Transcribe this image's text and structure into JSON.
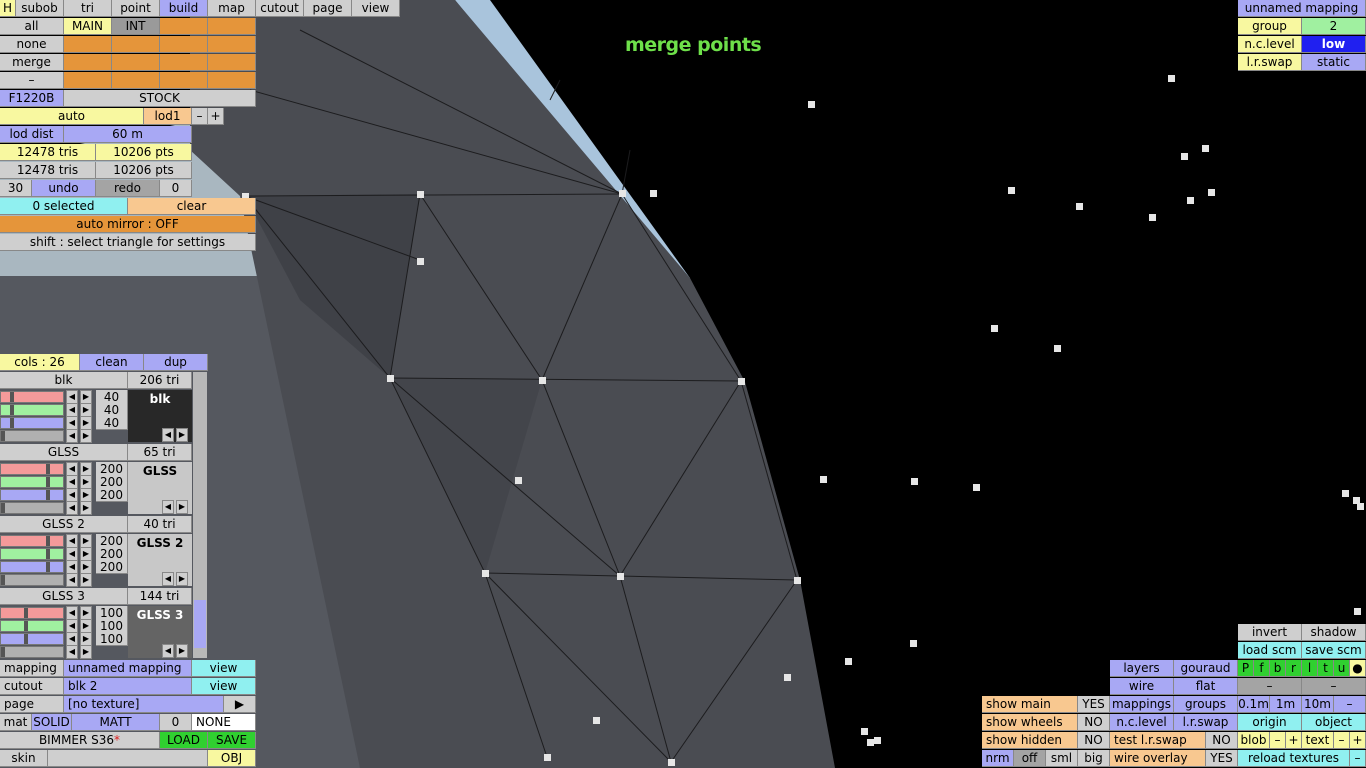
{
  "title": "merge points",
  "top_tabs": [
    "H",
    "subob",
    "tri",
    "point",
    "build",
    "map",
    "cutout",
    "page",
    "view"
  ],
  "selection_buttons": [
    "all",
    "none",
    "merge",
    "–"
  ],
  "main_label": "MAIN",
  "int_label": "INT",
  "model_code": "F1220B",
  "model_variant": "STOCK",
  "lod_mode": "auto",
  "lod_level": "lod1",
  "lod_minus": "–",
  "lod_plus": "+",
  "lod_dist_label": "lod dist",
  "lod_dist_value": "60 m",
  "tri_count_1": "12478 tris",
  "pt_count_1": "10206 pts",
  "tri_count_2": "12478 tris",
  "pt_count_2": "10206 pts",
  "undo_count": "30",
  "undo_label": "undo",
  "redo_label": "redo",
  "redo_count": "0",
  "selected_label": "0 selected",
  "clear_label": "clear",
  "auto_mirror_label": "auto mirror : OFF",
  "hint_label": "shift : select triangle for settings",
  "cols_label": "cols : 26",
  "clean_label": "clean",
  "dup_label": "dup",
  "materials": [
    {
      "name": "blk",
      "tris": "206 tri",
      "r": "40",
      "g": "40",
      "b": "40",
      "r_frac": 0.16,
      "g_frac": 0.16,
      "b_frac": 0.16,
      "swatch_label": "blk",
      "swatch_color": "#282828",
      "swatch_text": "#ffffff"
    },
    {
      "name": "GLSS",
      "tris": "65 tri",
      "r": "200",
      "g": "200",
      "b": "200",
      "r_frac": 0.78,
      "g_frac": 0.78,
      "b_frac": 0.78,
      "swatch_label": "GLSS",
      "swatch_color": "#c8c8c8",
      "swatch_text": "#000000"
    },
    {
      "name": "GLSS 2",
      "tris": "40 tri",
      "r": "200",
      "g": "200",
      "b": "200",
      "r_frac": 0.78,
      "g_frac": 0.78,
      "b_frac": 0.78,
      "swatch_label": "GLSS 2",
      "swatch_color": "#c8c8c8",
      "swatch_text": "#000000"
    },
    {
      "name": "GLSS 3",
      "tris": "144 tri",
      "r": "100",
      "g": "100",
      "b": "100",
      "r_frac": 0.39,
      "g_frac": 0.39,
      "b_frac": 0.39,
      "swatch_label": "GLSS 3",
      "swatch_color": "#646464",
      "swatch_text": "#ffffff"
    }
  ],
  "mapping_label": "mapping",
  "mapping_value": "unnamed mapping",
  "cutout_label": "cutout",
  "cutout_value": "blk 2",
  "view_label": "view",
  "page_label": "page",
  "page_value": "[no texture]",
  "page_arrow": "▶",
  "mat_label": "mat",
  "solid_label": "SOLID",
  "matt_label": "MATT",
  "mat_num": "0",
  "mat_none": "NONE",
  "car_name": "BIMMER S36",
  "car_modified": "*",
  "load_label": "LOAD",
  "save_label": "SAVE",
  "skin_label": "skin",
  "obj_label": "OBJ",
  "right_top": {
    "mapping_name": "unnamed mapping",
    "group_label": "group",
    "group_value": "2",
    "nclevel_label": "n.c.level",
    "nclevel_value": "low",
    "lrswap_label": "l.r.swap",
    "lrswap_value": "static"
  },
  "bottom_right": {
    "invert": "invert",
    "shadow": "shadow",
    "load_scm": "load scm",
    "save_scm": "save scm",
    "layers": "layers",
    "gouraud": "gouraud",
    "flags": [
      "P",
      "f",
      "b",
      "r",
      "l",
      "t",
      "u",
      "●"
    ],
    "wire": "wire",
    "flat": "flat",
    "dash": "–",
    "show_main": "show main",
    "show_main_val": "YES",
    "mappings": "mappings",
    "groups": "groups",
    "step_01": "0.1m",
    "step_1": "1m",
    "step_10": "10m",
    "step_minus": "–",
    "show_wheels": "show wheels",
    "show_wheels_val": "NO",
    "nclevel": "n.c.level",
    "lrswap": "l.r.swap",
    "origin": "origin",
    "object": "object",
    "show_hidden": "show hidden",
    "show_hidden_val": "NO",
    "test_lrswap": "test l.r.swap",
    "test_lrswap_val": "NO",
    "blob": "blob",
    "text": "text",
    "minus": "–",
    "plus": "+",
    "nrm": "nrm",
    "off": "off",
    "sml": "sml",
    "big": "big",
    "wire_overlay": "wire overlay",
    "wire_overlay_val": "YES",
    "reload_textures": "reload textures"
  }
}
